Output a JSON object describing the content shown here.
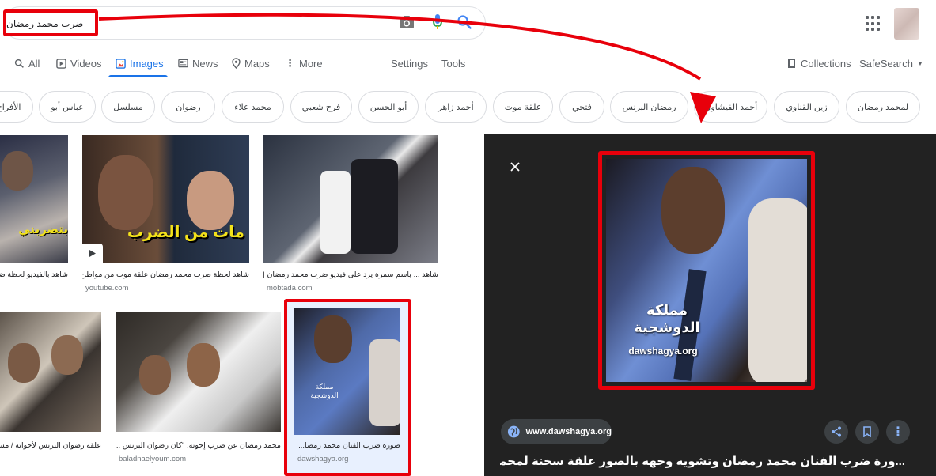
{
  "search": {
    "query": "ضرب محمد رمضان"
  },
  "tabs": [
    {
      "label": "All",
      "icon": "search-icon",
      "active": false
    },
    {
      "label": "Videos",
      "icon": "video-icon",
      "active": false
    },
    {
      "label": "Images",
      "icon": "image-icon",
      "active": true
    },
    {
      "label": "News",
      "icon": "news-icon",
      "active": false
    },
    {
      "label": "Maps",
      "icon": "map-pin-icon",
      "active": false
    },
    {
      "label": "More",
      "icon": "more-vert-icon",
      "active": false
    }
  ],
  "tools": {
    "settings": "Settings",
    "tools": "Tools",
    "collections": "Collections",
    "safesearch": "SafeSearch"
  },
  "chips": [
    "لمحمد رمضان",
    "زين القناوي",
    "أحمد الفيشاوي",
    "رمضان البرنس",
    "فتحي",
    "علقة موت",
    "أحمد زاهر",
    "أبو الحسن",
    "فرح شعبي",
    "محمد علاء",
    "رضوان",
    "مسلسل",
    "عباس أبو",
    "الأفراح"
  ],
  "results": [
    {
      "caption": "شاهد بالفيديو لحظة ضرب",
      "source": "",
      "overlay": "بتضربني"
    },
    {
      "caption": "شاهد لحظة ضرب محمد رمضان علقة موت من مواطن...",
      "source": "youtube.com",
      "overlay": "مات من الضرب"
    },
    {
      "caption": "شاهد ... باسم سمرة يرد على فيديو ضرب محمد رمضان | م...",
      "source": "mobtada.com",
      "overlay": ""
    },
    {
      "caption": "علقة رضوان البرنس لأخواته / مسل",
      "source": "",
      "overlay": ""
    },
    {
      "caption": "محمد رمضان عن ضرب إخوته: \"كان رضوان البرنس ...",
      "source": "baladnaelyoum.com",
      "overlay": ""
    },
    {
      "caption": "صورة ضرب الفنان محمد رمضا...",
      "source": "dawshagya.org",
      "overlay": ""
    }
  ],
  "preview": {
    "watermark_line1": "مملكة",
    "watermark_line2": "الدوشجية",
    "watermark_site": "dawshagya.org",
    "site": "www.dawshagya.org",
    "title": "...ورة ضرب الفنان محمد رمضان وتشويه وجهه بالصور علقة سخنة لمحمد رمضان ونزول"
  },
  "colors": {
    "accent": "#1a73e8",
    "highlight": "#e8000b",
    "panel": "#222222"
  }
}
